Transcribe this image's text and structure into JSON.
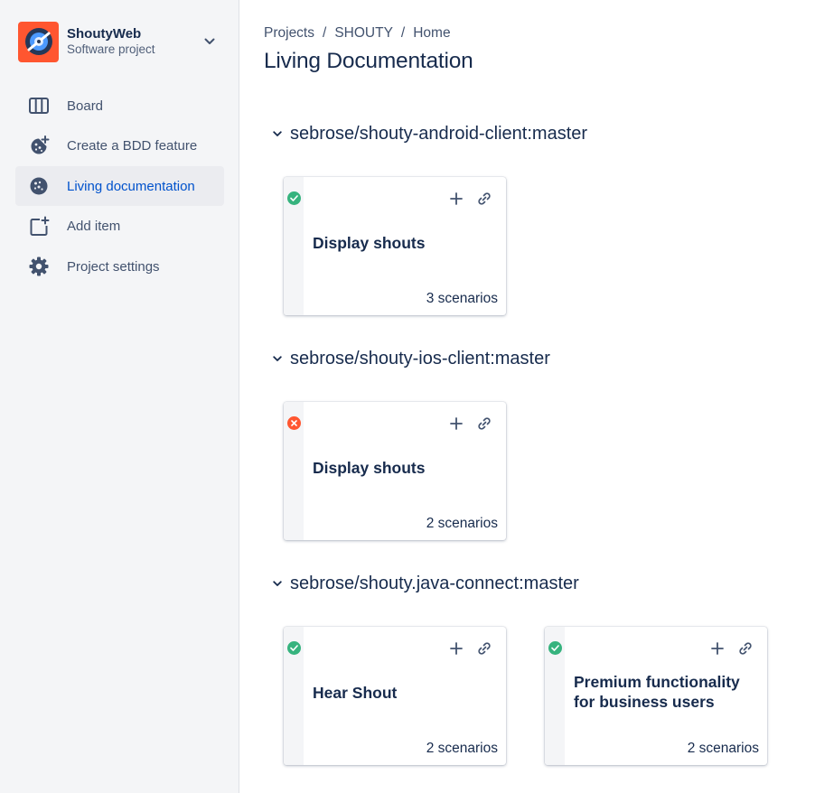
{
  "sidebar": {
    "project": {
      "name": "ShoutyWeb",
      "type": "Software project",
      "avatar_color": "#FF5630"
    },
    "items": [
      {
        "label": "Board",
        "icon": "board-icon",
        "active": false
      },
      {
        "label": "Create a BDD feature",
        "icon": "bdd-feature-icon",
        "active": false
      },
      {
        "label": "Living documentation",
        "icon": "living-doc-icon",
        "active": true
      },
      {
        "label": "Add item",
        "icon": "add-item-icon",
        "active": false
      },
      {
        "label": "Project settings",
        "icon": "gear-icon",
        "active": false
      }
    ]
  },
  "main": {
    "breadcrumb": [
      "Projects",
      "SHOUTY",
      "Home"
    ],
    "title": "Living Documentation",
    "sections": [
      {
        "repo": "sebrose/shouty-android-client:master",
        "cards": [
          {
            "title": "Display shouts",
            "scenarios": "3 scenarios",
            "status": "passed"
          }
        ]
      },
      {
        "repo": "sebrose/shouty-ios-client:master",
        "cards": [
          {
            "title": "Display shouts",
            "scenarios": "2 scenarios",
            "status": "failed"
          }
        ]
      },
      {
        "repo": "sebrose/shouty.java-connect:master",
        "cards": [
          {
            "title": "Hear Shout",
            "scenarios": "2 scenarios",
            "status": "passed"
          },
          {
            "title": "Premium functionality for business users",
            "scenarios": "2 scenarios",
            "status": "passed"
          }
        ]
      }
    ]
  },
  "colors": {
    "passed": "#36B37E",
    "failed": "#FF5630",
    "active_nav": "#0052CC"
  }
}
